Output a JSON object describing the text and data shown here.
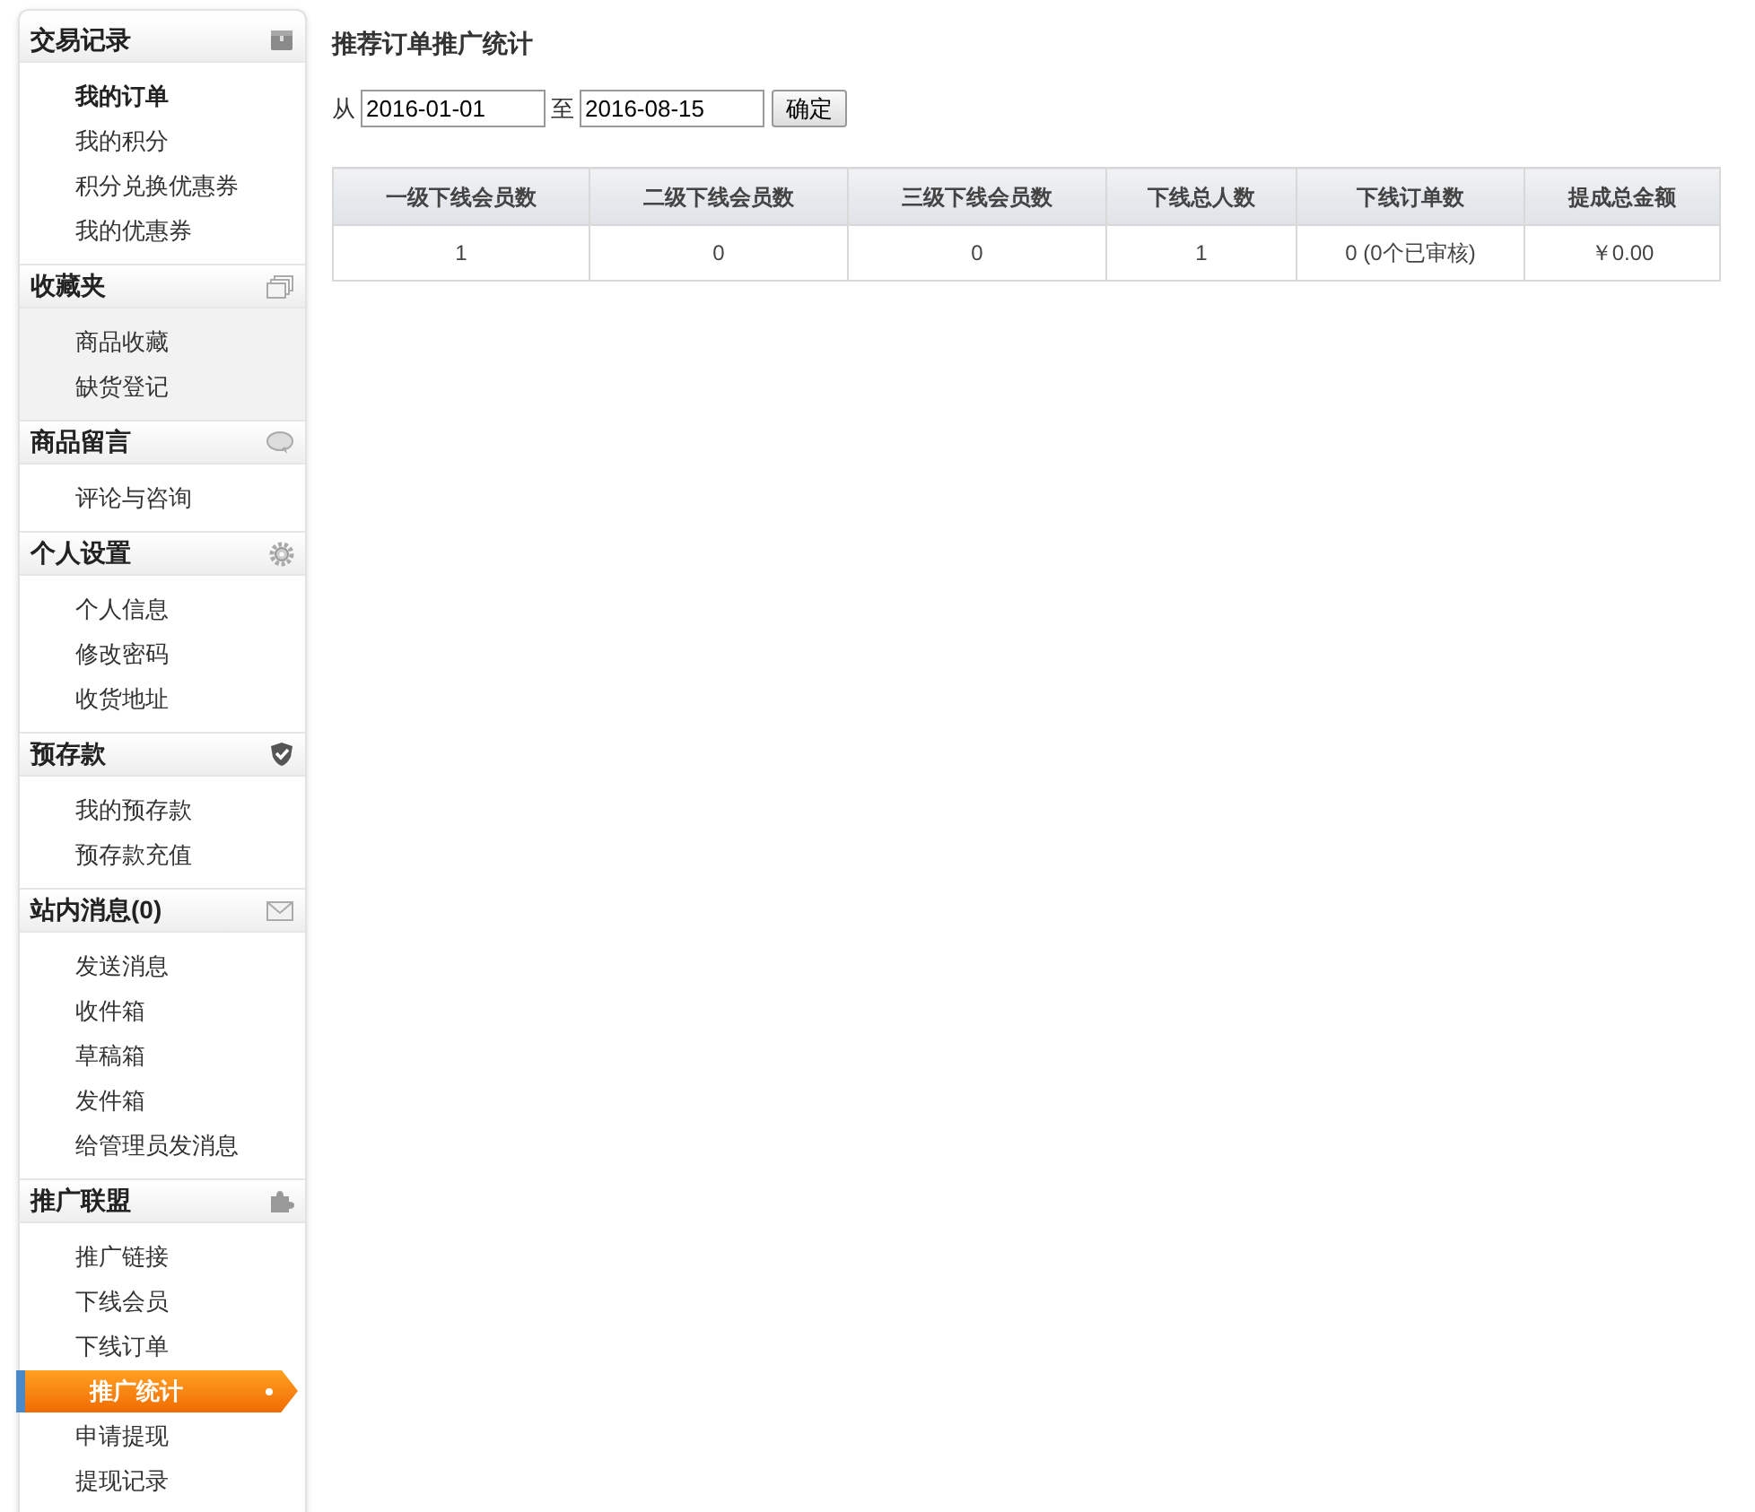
{
  "sidebar": {
    "sections": [
      {
        "title": "交易记录",
        "shaded": false,
        "items": [
          {
            "label": "我的订单",
            "bold": true,
            "selected": false
          },
          {
            "label": "我的积分",
            "bold": false,
            "selected": false
          },
          {
            "label": "积分兑换优惠券",
            "bold": false,
            "selected": false
          },
          {
            "label": "我的优惠券",
            "bold": false,
            "selected": false
          }
        ]
      },
      {
        "title": "收藏夹",
        "shaded": true,
        "items": [
          {
            "label": "商品收藏",
            "bold": false,
            "selected": false
          },
          {
            "label": "缺货登记",
            "bold": false,
            "selected": false
          }
        ]
      },
      {
        "title": "商品留言",
        "shaded": false,
        "items": [
          {
            "label": "评论与咨询",
            "bold": false,
            "selected": false
          }
        ]
      },
      {
        "title": "个人设置",
        "shaded": false,
        "items": [
          {
            "label": "个人信息",
            "bold": false,
            "selected": false
          },
          {
            "label": "修改密码",
            "bold": false,
            "selected": false
          },
          {
            "label": "收货地址",
            "bold": false,
            "selected": false
          }
        ]
      },
      {
        "title": "预存款",
        "shaded": false,
        "items": [
          {
            "label": "我的预存款",
            "bold": false,
            "selected": false
          },
          {
            "label": "预存款充值",
            "bold": false,
            "selected": false
          }
        ]
      },
      {
        "title": "站内消息(0)",
        "shaded": false,
        "items": [
          {
            "label": "发送消息",
            "bold": false,
            "selected": false
          },
          {
            "label": "收件箱",
            "bold": false,
            "selected": false
          },
          {
            "label": "草稿箱",
            "bold": false,
            "selected": false
          },
          {
            "label": "发件箱",
            "bold": false,
            "selected": false
          },
          {
            "label": "给管理员发消息",
            "bold": false,
            "selected": false
          }
        ]
      },
      {
        "title": "推广联盟",
        "shaded": false,
        "items": [
          {
            "label": "推广链接",
            "bold": false,
            "selected": false
          },
          {
            "label": "下线会员",
            "bold": false,
            "selected": false
          },
          {
            "label": "下线订单",
            "bold": false,
            "selected": false
          },
          {
            "label": "推广统计",
            "bold": false,
            "selected": true
          },
          {
            "label": "申请提现",
            "bold": false,
            "selected": false
          },
          {
            "label": "提现记录",
            "bold": false,
            "selected": false
          }
        ]
      }
    ]
  },
  "main": {
    "title": "推荐订单推广统计",
    "filter": {
      "from_label": "从",
      "from": "2016-01-01",
      "to_label": "至",
      "to": "2016-08-15",
      "button": "确定"
    },
    "table": {
      "columns": [
        "一级下线会员数",
        "二级下线会员数",
        "三级下线会员数",
        "下线总人数",
        "下线订单数",
        "提成总金额"
      ],
      "rows": [
        [
          "1",
          "0",
          "0",
          "1",
          "0 (0个已审核)",
          "￥0.00"
        ]
      ]
    }
  }
}
